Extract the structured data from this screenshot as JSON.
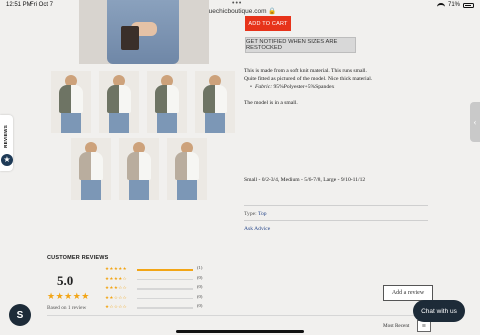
{
  "status_bar": {
    "time": "12:51 PM",
    "date": "Fri Oct 7",
    "url": "bluechicboutique.com",
    "battery": "71%",
    "dots": "•••"
  },
  "product": {
    "add_to_cart": "ADD TO CART",
    "notify_label": "GET NOTIFIED WHEN SIZES ARE RESTOCKED",
    "desc_line1": "This is made from a soft knit material. This runs small.",
    "desc_line2": "Quite fitted as pictured of the model. Nice thick material.",
    "fabric_label": "Fabric:",
    "fabric_value": "95%Polyester+5%Spandex",
    "model_note": "The model is in a small.",
    "sizes": "Small - 0/2-3/4, Medium - 5/6-7/8, Large - 9/10-11/12",
    "type_label": "Type:",
    "type_value": "Top",
    "ask_advice": "Ask Advice"
  },
  "reviews_tab": {
    "label": "REVIEWS",
    "badge_icon": "star-icon"
  },
  "reviews": {
    "title": "CUSTOMER REVIEWS",
    "average": "5.0",
    "average_stars": "★★★★★",
    "based_on": "Based on 1 review",
    "histogram": [
      {
        "stars": "★★★★★",
        "count": "(1)",
        "fraction": 1.0
      },
      {
        "stars": "★★★★☆",
        "count": "(0)",
        "fraction": 0
      },
      {
        "stars": "★★★☆☆",
        "count": "(0)",
        "fraction": 0
      },
      {
        "stars": "★★☆☆☆",
        "count": "(0)",
        "fraction": 0
      },
      {
        "stars": "★☆☆☆☆",
        "count": "(0)",
        "fraction": 0
      }
    ],
    "add_review": "Add a review",
    "sort_label": "Most Recent",
    "sort_icon": "filter-icon"
  },
  "chat": {
    "label": "Chat with us"
  },
  "shopify": {
    "icon_glyph": "S",
    "icon": "shopify-bag-icon"
  },
  "edge_handle": {
    "icon_glyph": "‹",
    "icon": "chevron-left-icon"
  },
  "colors": {
    "accent_red": "#e7331a",
    "star_gold": "#f2a516",
    "dark_navy": "#1d2b38",
    "link_blue": "#2b4a8c"
  }
}
